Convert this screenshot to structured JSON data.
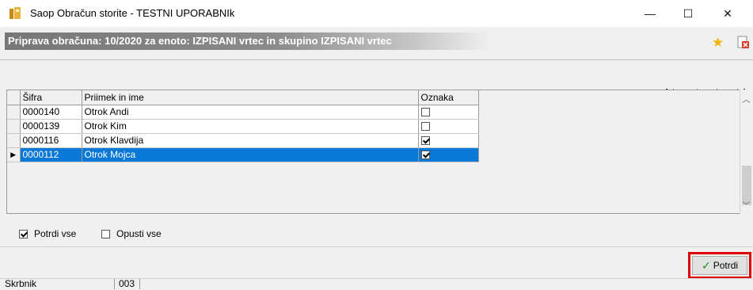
{
  "window": {
    "title": "Saop Obračun storite - TESTNI UPORABNIk",
    "min_icon": "—",
    "max_icon": "☐",
    "close_icon": "✕"
  },
  "header": {
    "title": "Priprava obračuna: 10/2020 za enoto: IZPISANI vrtec in skupino IZPISANI vrtec",
    "star_icon": "star-icon",
    "doc_icon": "delete-doc-icon"
  },
  "nav": {
    "first": "⏮",
    "prev": "◀",
    "next": "▶",
    "last": "⏭"
  },
  "grid": {
    "columns": [
      "Šifra",
      "Priimek in ime",
      "Oznaka"
    ],
    "rows": [
      {
        "sifra": "0000140",
        "name": "Otrok Andi",
        "checked": false
      },
      {
        "sifra": "0000139",
        "name": "Otrok Kim",
        "checked": false
      },
      {
        "sifra": "0000116",
        "name": "Otrok Klavdija",
        "checked": true
      },
      {
        "sifra": "0000112",
        "name": "Otrok Mojca",
        "checked": true
      }
    ],
    "selected_row": 3,
    "row_indicator": "▶"
  },
  "options": {
    "confirm_all": "Potrdi vse",
    "skip_all": "Opusti vse"
  },
  "actions": {
    "confirm_label": "Potrdi"
  },
  "status": {
    "label": "Skrbnik",
    "code": "003"
  },
  "colors": {
    "selection": "#0a78d7",
    "highlight": "#e00000",
    "header_gradient": "#777777"
  }
}
